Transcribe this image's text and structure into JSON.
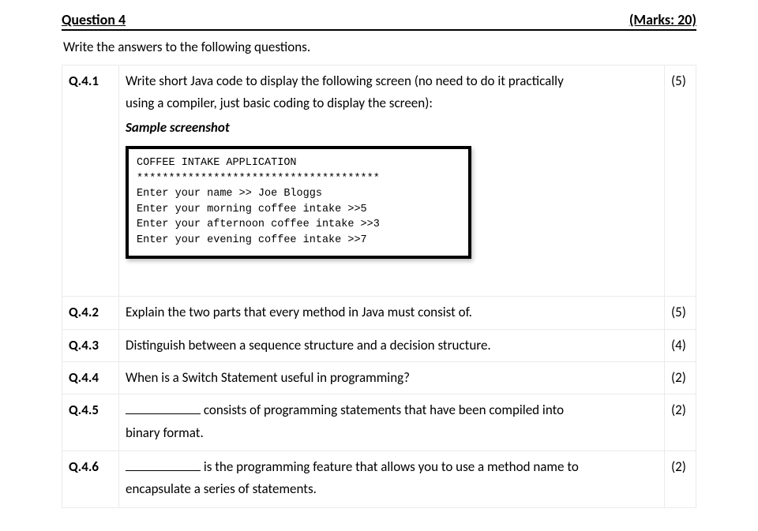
{
  "header": {
    "title": "Question 4",
    "marks": "(Marks: 20)"
  },
  "instruction": "Write the answers to the following questions.",
  "rows": [
    {
      "num": "Q.4.1",
      "line1": "Write short Java code to display the following screen (no need to do it practically",
      "line2": "using a compiler, just basic coding to display the screen):",
      "sampleLabel": "Sample screenshot",
      "marks": "(5)",
      "console": {
        "l1": "COFFEE INTAKE APPLICATION",
        "l2": "**************************************",
        "l3": "Enter your name >> Joe Bloggs",
        "l4": "Enter your morning coffee intake >>5",
        "l5": "Enter your afternoon coffee intake >>3",
        "l6": "Enter your evening coffee intake >>7"
      }
    },
    {
      "num": "Q.4.2",
      "text": "Explain the two parts that every method in Java must consist of.",
      "marks": "(5)"
    },
    {
      "num": "Q.4.3",
      "text": "Distinguish between a sequence structure and a decision structure.",
      "marks": "(4)"
    },
    {
      "num": "Q.4.4",
      "text": "When is a Switch Statement useful in programming?",
      "marks": "(2)"
    },
    {
      "num": "Q.4.5",
      "textAfterBlank1": " consists of programming statements that have been compiled into",
      "textLine2": "binary format.",
      "marks": "(2)"
    },
    {
      "num": "Q.4.6",
      "textAfterBlank1": " is the programming feature that allows you to use a method name to",
      "textLine2": "encapsulate a series of statements.",
      "marks": "(2)"
    }
  ]
}
